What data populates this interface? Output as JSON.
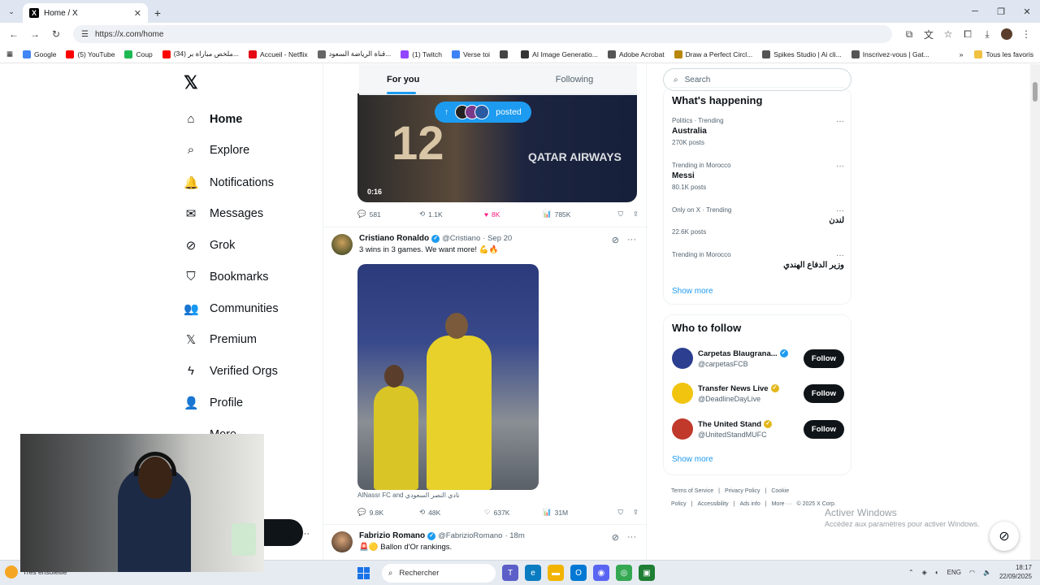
{
  "browser": {
    "tab_title": "Home / X",
    "url": "https://x.com/home",
    "bookmarks": [
      {
        "label": "Google",
        "color": "#4285f4"
      },
      {
        "label": "(5) YouTube",
        "color": "#ff0000"
      },
      {
        "label": "Coup",
        "color": "#1db954"
      },
      {
        "label": "(34) ملخص مباراة بر...",
        "color": "#ff0000"
      },
      {
        "label": "Accueil - Netflix",
        "color": "#e50914"
      },
      {
        "label": "قناة الرياضة السعود...",
        "color": "#666666"
      },
      {
        "label": "(1) Twitch",
        "color": "#9146ff"
      },
      {
        "label": "Verse toi",
        "color": "#3b82f6"
      },
      {
        "label": "",
        "color": "#444444"
      },
      {
        "label": "AI Image Generatio...",
        "color": "#333333"
      },
      {
        "label": "Adobe Acrobat",
        "color": "#555555"
      },
      {
        "label": "Draw a Perfect Circl...",
        "color": "#b8860b"
      },
      {
        "label": "Spikes Studio | Ai cli...",
        "color": "#555555"
      },
      {
        "label": "Inscrivez-vous | Gat...",
        "color": "#555555"
      }
    ],
    "all_bookmarks": "Tous les favoris"
  },
  "nav": {
    "items": [
      {
        "label": "Home",
        "icon": "home-icon",
        "glyph": "⌂"
      },
      {
        "label": "Explore",
        "icon": "search-icon",
        "glyph": "⌕"
      },
      {
        "label": "Notifications",
        "icon": "bell-icon",
        "glyph": "🔔"
      },
      {
        "label": "Messages",
        "icon": "envelope-icon",
        "glyph": "✉"
      },
      {
        "label": "Grok",
        "icon": "grok-icon",
        "glyph": "⊘"
      },
      {
        "label": "Bookmarks",
        "icon": "bookmark-icon",
        "glyph": "⛉"
      },
      {
        "label": "Communities",
        "icon": "communities-icon",
        "glyph": "👥"
      },
      {
        "label": "Premium",
        "icon": "x-logo-icon",
        "glyph": "𝕏"
      },
      {
        "label": "Verified Orgs",
        "icon": "lightning-icon",
        "glyph": "ϟ"
      },
      {
        "label": "Profile",
        "icon": "person-icon",
        "glyph": "👤"
      },
      {
        "label": "More",
        "icon": "more-circle-icon",
        "glyph": "⋯"
      }
    ]
  },
  "feed": {
    "tabs": [
      "For you",
      "Following"
    ],
    "posted_pill": "posted",
    "video": {
      "number": "12",
      "duration": "0:16",
      "jersey": "QATAR AIRWAYS"
    },
    "tweet1_stats": {
      "replies": "581",
      "reposts": "1.1K",
      "likes": "8K",
      "views": "785K"
    },
    "tweet2": {
      "name": "Cristiano Ronaldo",
      "handle": "@Cristiano",
      "time": "· Sep 20",
      "text": "3 wins in 3 games. We want more! 💪🔥",
      "caption": "AlNassr FC and نادي النصر السعودي",
      "stats": {
        "replies": "9.8K",
        "reposts": "48K",
        "likes": "637K",
        "views": "31M"
      }
    },
    "tweet3": {
      "name": "Fabrizio Romano",
      "handle": "@FabrizioRomano",
      "time": "· 18m",
      "text": "🚨🟡 Ballon d'Or rankings."
    }
  },
  "sidebar": {
    "search_placeholder": "Search",
    "happening_title": "What's happening",
    "trends": [
      {
        "meta": "Politics · Trending",
        "topic": "Australia",
        "count": "270K posts",
        "rtl": false
      },
      {
        "meta": "Trending in Morocco",
        "topic": "Messi",
        "count": "80.1K posts",
        "rtl": false
      },
      {
        "meta": "Only on X · Trending",
        "topic": "لندن",
        "count": "22.6K posts",
        "rtl": true
      },
      {
        "meta": "Trending in Morocco",
        "topic": "وزير الدفاع الهندي",
        "count": "",
        "rtl": true
      }
    ],
    "show_more": "Show more",
    "who_title": "Who to follow",
    "follow_label": "Follow",
    "who": [
      {
        "name": "Carpetas Blaugrana...",
        "handle": "@carpetasFCB",
        "badge": "blue",
        "color": "#2c3e8f"
      },
      {
        "name": "Transfer News Live",
        "handle": "@DeadlineDayLive",
        "badge": "gold",
        "color": "#f1c40f"
      },
      {
        "name": "The United Stand",
        "handle": "@UnitedStandMUFC",
        "badge": "gold",
        "color": "#c0392b"
      }
    ],
    "footer": [
      "Terms of Service",
      "|",
      "Privacy Policy",
      "|",
      "Cookie Policy",
      "|",
      "Accessibility",
      "|",
      "Ads info",
      "|",
      "More ···",
      "© 2025 X Corp."
    ]
  },
  "overlay": {
    "activate_title": "Activer Windows",
    "activate_sub": "Accédez aux paramètres pour activer Windows."
  },
  "taskbar": {
    "weather": "Très ensoleillé",
    "search": "Rechercher",
    "lang": "ENG",
    "time": "18:17",
    "date": "22/09/2025"
  }
}
